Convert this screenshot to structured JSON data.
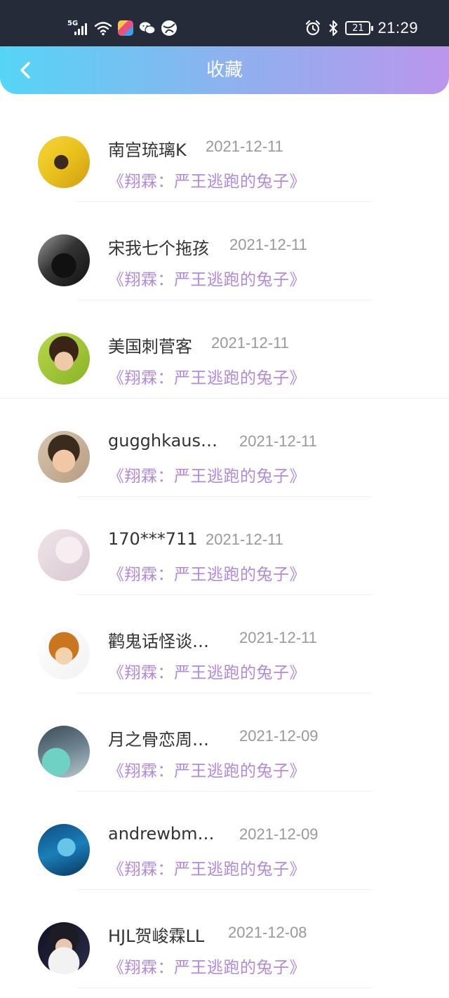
{
  "status_bar": {
    "network": "5G",
    "battery": "21",
    "time": "21:29"
  },
  "header": {
    "title": "收藏"
  },
  "items": [
    {
      "name": "南宫琉璃K",
      "date": "2021-12-11",
      "book": "《翔霖：严王逃跑的兔子》"
    },
    {
      "name": "宋我七个拖孩",
      "date": "2021-12-11",
      "book": "《翔霖：严王逃跑的兔子》"
    },
    {
      "name": "美国刺菅客",
      "date": "2021-12-11",
      "book": "《翔霖：严王逃跑的兔子》"
    },
    {
      "name": "gugghkaus…",
      "date": "2021-12-11",
      "book": "《翔霖：严王逃跑的兔子》"
    },
    {
      "name": "170***711",
      "date": "2021-12-11",
      "book": "《翔霖：严王逃跑的兔子》"
    },
    {
      "name": "鹳鬼话怪谈…",
      "date": "2021-12-11",
      "book": "《翔霖：严王逃跑的兔子》"
    },
    {
      "name": "月之骨恋周…",
      "date": "2021-12-09",
      "book": "《翔霖：严王逃跑的兔子》"
    },
    {
      "name": "andrewbm…",
      "date": "2021-12-09",
      "book": "《翔霖：严王逃跑的兔子》"
    },
    {
      "name": "HJL贺峻霖LL",
      "date": "2021-12-08",
      "book": "《翔霖：严王逃跑的兔子》"
    }
  ],
  "colors": {
    "header_gradient_start": "#55d5f6",
    "header_gradient_end": "#bb96ec",
    "book_title": "#b18ae0",
    "date": "#999999",
    "name": "#333333"
  }
}
